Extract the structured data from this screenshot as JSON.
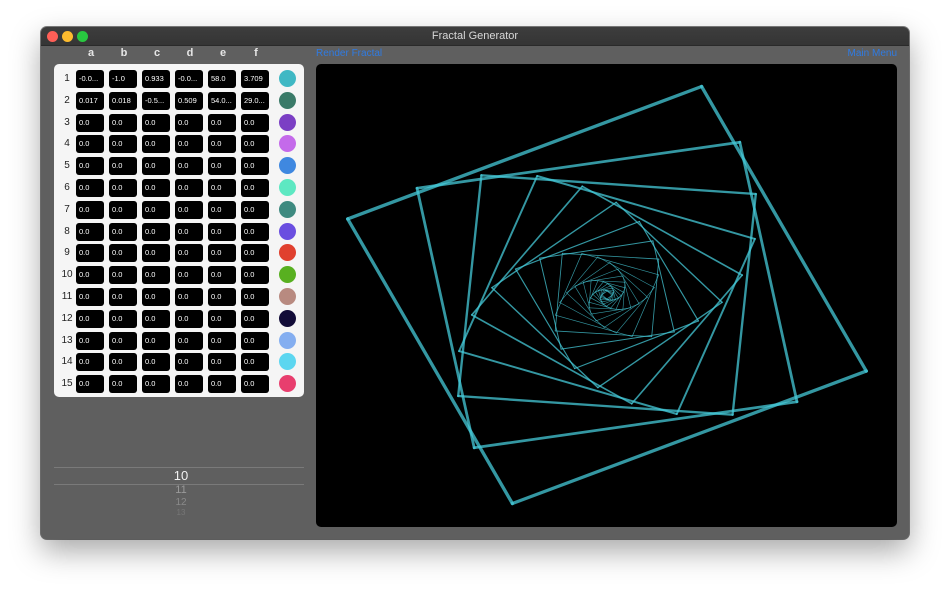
{
  "window": {
    "title": "Fractal Generator"
  },
  "toolbar": {
    "render_label": "Render Fractal",
    "menu_label": "Main Menu"
  },
  "columns": [
    "a",
    "b",
    "c",
    "d",
    "e",
    "f"
  ],
  "rows": [
    {
      "num": "1",
      "values": [
        "-0.0...",
        "-1.0",
        "0.933",
        "-0.0...",
        "58.0",
        "3.709"
      ],
      "color": "#3fb8c4"
    },
    {
      "num": "2",
      "values": [
        "0.017",
        "0.018",
        "-0.5...",
        "0.509",
        "54.0...",
        "29.0..."
      ],
      "color": "#3a7a68"
    },
    {
      "num": "3",
      "values": [
        "0.0",
        "0.0",
        "0.0",
        "0.0",
        "0.0",
        "0.0"
      ],
      "color": "#7b3fc4"
    },
    {
      "num": "4",
      "values": [
        "0.0",
        "0.0",
        "0.0",
        "0.0",
        "0.0",
        "0.0"
      ],
      "color": "#c46aea"
    },
    {
      "num": "5",
      "values": [
        "0.0",
        "0.0",
        "0.0",
        "0.0",
        "0.0",
        "0.0"
      ],
      "color": "#3f88e0"
    },
    {
      "num": "6",
      "values": [
        "0.0",
        "0.0",
        "0.0",
        "0.0",
        "0.0",
        "0.0"
      ],
      "color": "#5de8c2"
    },
    {
      "num": "7",
      "values": [
        "0.0",
        "0.0",
        "0.0",
        "0.0",
        "0.0",
        "0.0"
      ],
      "color": "#3e8a80"
    },
    {
      "num": "8",
      "values": [
        "0.0",
        "0.0",
        "0.0",
        "0.0",
        "0.0",
        "0.0"
      ],
      "color": "#6a4ee0"
    },
    {
      "num": "9",
      "values": [
        "0.0",
        "0.0",
        "0.0",
        "0.0",
        "0.0",
        "0.0"
      ],
      "color": "#e0402e"
    },
    {
      "num": "10",
      "values": [
        "0.0",
        "0.0",
        "0.0",
        "0.0",
        "0.0",
        "0.0"
      ],
      "color": "#58b020"
    },
    {
      "num": "11",
      "values": [
        "0.0",
        "0.0",
        "0.0",
        "0.0",
        "0.0",
        "0.0"
      ],
      "color": "#b88a80"
    },
    {
      "num": "12",
      "values": [
        "0.0",
        "0.0",
        "0.0",
        "0.0",
        "0.0",
        "0.0"
      ],
      "color": "#120c38"
    },
    {
      "num": "13",
      "values": [
        "0.0",
        "0.0",
        "0.0",
        "0.0",
        "0.0",
        "0.0"
      ],
      "color": "#84aef0"
    },
    {
      "num": "14",
      "values": [
        "0.0",
        "0.0",
        "0.0",
        "0.0",
        "0.0",
        "0.0"
      ],
      "color": "#5cd6f0"
    },
    {
      "num": "15",
      "values": [
        "0.0",
        "0.0",
        "0.0",
        "0.0",
        "0.0",
        "0.0"
      ],
      "color": "#e83e6e"
    }
  ],
  "picker": {
    "selected": "10",
    "options": [
      "11",
      "12",
      "13"
    ]
  },
  "canvas": {
    "line_color": "#46c9d8",
    "background": "#000000"
  }
}
